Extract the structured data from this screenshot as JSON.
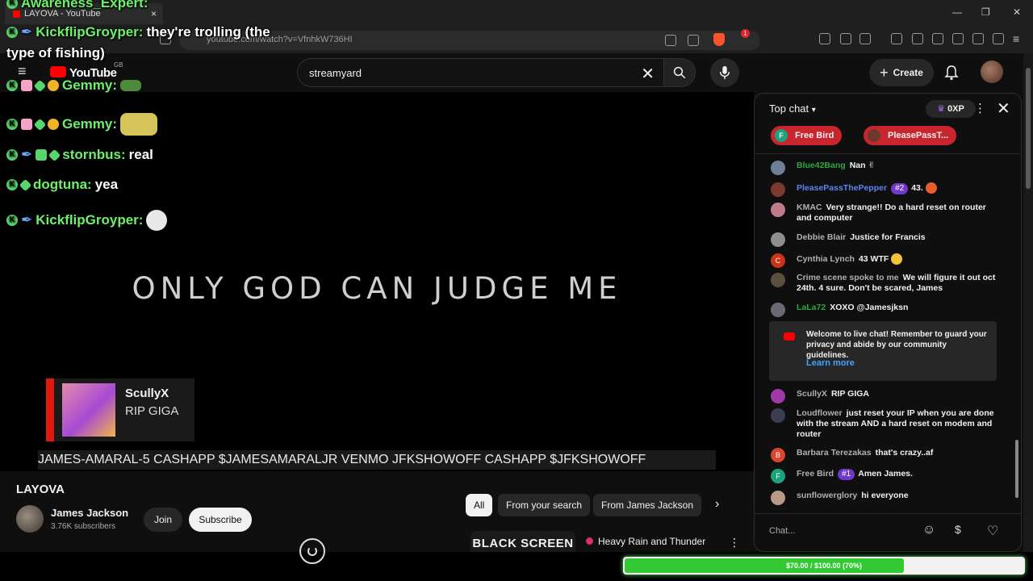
{
  "browser": {
    "tab_title": "LAYOVA - YouTube",
    "tab_close": "×",
    "url": "youtube.com/watch?v=VfnhkW736HI",
    "notification_count": "1",
    "window_buttons": [
      "—",
      "❐",
      "✕"
    ]
  },
  "youtube": {
    "logo": "YouTube",
    "region": "GB",
    "search_value": "streamyard",
    "create_label": "Create"
  },
  "video": {
    "overlay_text": "ONLY GOD CAN JUDGE ME",
    "card": {
      "name": "ScullyX",
      "message": "RIP GIGA"
    },
    "ticker": "JAMES-AMARAL-5 CASHAPP $JAMESAMARALJR VENMO JFKSHOWOFF CASHAPP $JFKSHOWOFF",
    "overlay_chat": [
      {
        "name": "Awareness_Expert:",
        "text": ""
      },
      {
        "name": "KickflipGroyper:",
        "text": "they're trolling (the"
      },
      {
        "name": "",
        "text": "type of fishing)"
      },
      {
        "name": "Gemmy:",
        "text": ""
      },
      {
        "name": "Gemmy:",
        "text": ""
      },
      {
        "name": "stornbus:",
        "text": "real"
      },
      {
        "name": "dogtuna:",
        "text": "yea"
      },
      {
        "name": "KickflipGroyper:",
        "text": ""
      }
    ]
  },
  "below_video": {
    "title": "LAYOVA",
    "channel": "James Jackson",
    "subscribers": "3.76K subscribers",
    "join": "Join",
    "subscribe": "Subscribe",
    "chips": [
      "All",
      "From your search",
      "From James Jackson"
    ],
    "rec_thumb_text": "BLACK SCREEN",
    "rec_title": "Heavy Rain and Thunder"
  },
  "chat": {
    "mode": "Top chat",
    "xp": "0XP",
    "pinned": [
      {
        "initial": "F",
        "name": "Free Bird"
      },
      {
        "initial": "",
        "name": "PleasePassT..."
      }
    ],
    "messages": [
      {
        "author": "Blue42Bang",
        "text": "Nan"
      },
      {
        "author": "PleasePassThePepper",
        "rank": "#2",
        "text": "43."
      },
      {
        "author": "KMAC",
        "text": "Very strange!! Do a hard reset on router and computer"
      },
      {
        "author": "Debbie Blair",
        "text": "Justice for Francis"
      },
      {
        "author": "Cynthia Lynch",
        "initial": "C",
        "text": "43 WTF"
      },
      {
        "author": "Crime scene spoke to me",
        "text": "We will figure it out oct 24th. 4 sure. Don't be scared, James"
      },
      {
        "author": "LaLa72",
        "text": "XOXO @Jamesjksn"
      },
      {
        "author": "ScullyX",
        "text": "RIP GIGA"
      },
      {
        "author": "Loudflower",
        "text": "just reset your IP when you are done with the stream AND a hard reset on modem and router"
      },
      {
        "author": "Barbara Terezakas",
        "initial": "B",
        "text": "that's crazy..af"
      },
      {
        "author": "Free Bird",
        "initial": "F",
        "rank": "#1",
        "text": "Amen James."
      },
      {
        "author": "sunflowerglory",
        "text": "hi everyone"
      }
    ],
    "welcome": "Welcome to live chat! Remember to guard your privacy and abide by our community guidelines.",
    "learn_more": "Learn more",
    "input_placeholder": "Chat..."
  },
  "goal": {
    "label": "$70.00 / $100.00 (70%)",
    "fraction": 0.7
  }
}
